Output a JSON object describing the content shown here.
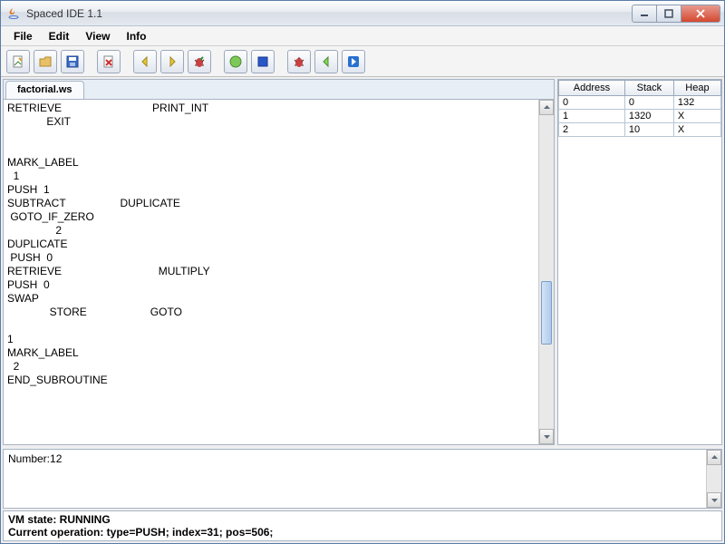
{
  "window": {
    "title": "Spaced IDE 1.1"
  },
  "menu": {
    "file": "File",
    "edit": "Edit",
    "view": "View",
    "info": "Info"
  },
  "tabs": [
    {
      "label": "factorial.ws"
    }
  ],
  "editor_text": "RETRIEVE                              PRINT_INT\n             EXIT\n\n\nMARK_LABEL\n  1\nPUSH  1\nSUBTRACT                  DUPLICATE\n GOTO_IF_ZERO\n                2\nDUPLICATE\n PUSH  0\nRETRIEVE                                MULTIPLY\nPUSH  0\nSWAP\n              STORE                     GOTO\n\n1\nMARK_LABEL\n  2\nEND_SUBROUTINE",
  "memtable": {
    "headers": {
      "address": "Address",
      "stack": "Stack",
      "heap": "Heap"
    },
    "rows": [
      {
        "address": "0",
        "stack": "0",
        "heap": "132"
      },
      {
        "address": "1",
        "stack": "1320",
        "heap": "X"
      },
      {
        "address": "2",
        "stack": "10",
        "heap": "X"
      }
    ]
  },
  "output": "Number:12",
  "status": {
    "vm": "VM state: RUNNING",
    "op": "Current operation: type=PUSH; index=31; pos=506;"
  },
  "colors": {
    "close_red": "#d4492f",
    "accent_blue": "#2e6fd4"
  }
}
